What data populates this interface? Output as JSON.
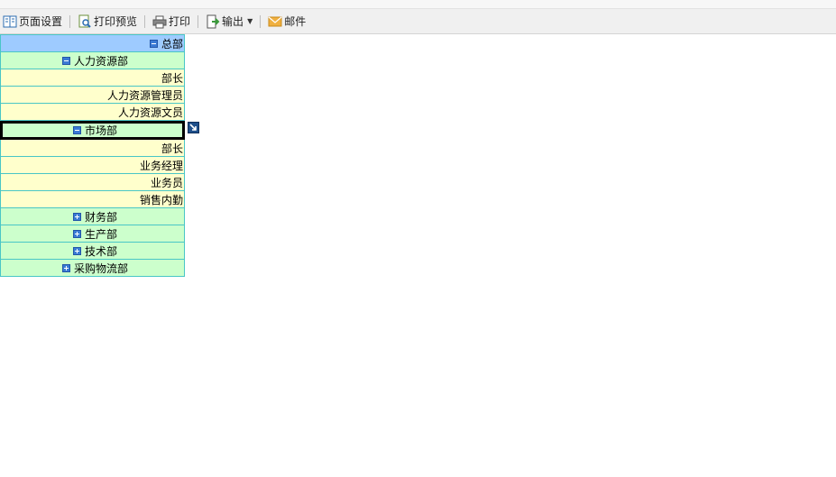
{
  "toolbar": {
    "page_setup": "页面设置",
    "print_preview": "打印预览",
    "print": "打印",
    "export": "输出",
    "mail": "邮件"
  },
  "report": {
    "root": "总部",
    "hr": {
      "name": "人力资源部",
      "items": [
        "部长",
        "人力资源管理员",
        "人力资源文员"
      ]
    },
    "market": {
      "name": "市场部",
      "items": [
        "部长",
        "业务经理",
        "业务员",
        "销售内勤"
      ]
    },
    "finance": "财务部",
    "production": "生产部",
    "tech": "技术部",
    "procurement": "采购物流部"
  },
  "colors": {
    "header_bg": "#9ecbff",
    "group_bg": "#ccffcc",
    "item_bg": "#ffffcc",
    "border": "#49c6c6",
    "selected_border": "#000000"
  }
}
